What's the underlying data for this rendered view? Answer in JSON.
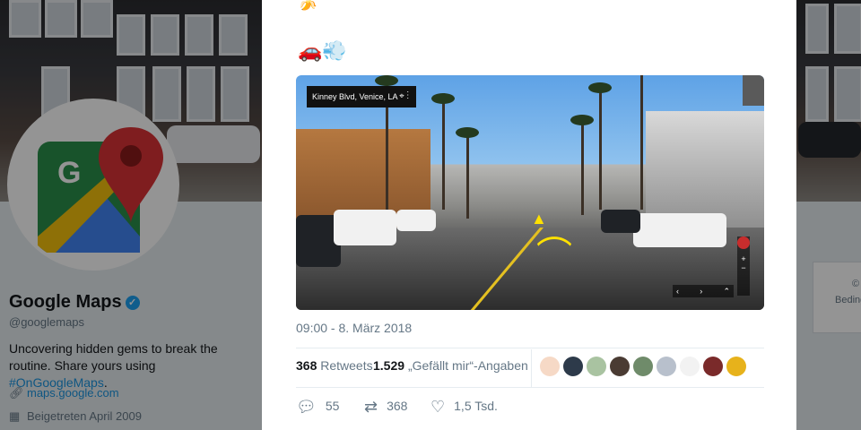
{
  "profile": {
    "name": "Google Maps",
    "handle": "@googlemaps",
    "bio_line1": "Uncovering hidden gems to break the",
    "bio_line2_prefix": "routine. Share yours using ",
    "bio_hashtag": "#OnGoogleMaps",
    "bio_suffix": ".",
    "website": "maps.google.com",
    "joined": "Beigetreten April 2009",
    "link_color": "#1b95e0"
  },
  "tweet": {
    "timestamp": "09:00 - 8. März 2018",
    "retweets_count": "368",
    "retweets_label": "Retweets",
    "likes_count": "1.529",
    "likes_label": "„Gefällt mir“-Angaben",
    "media": {
      "location_label": "Kinney Blvd, Venice, LA"
    }
  },
  "actions": {
    "replies": "55",
    "retweets": "368",
    "likes": "1,5 Tsd."
  },
  "right_card": {
    "line1": "©",
    "line2": "Beding"
  },
  "icons": {
    "verified": "verified-badge-icon",
    "link": "link-icon",
    "calendar": "calendar-icon",
    "reply": "reply-icon",
    "retweet": "retweet-icon",
    "like": "heart-icon"
  }
}
